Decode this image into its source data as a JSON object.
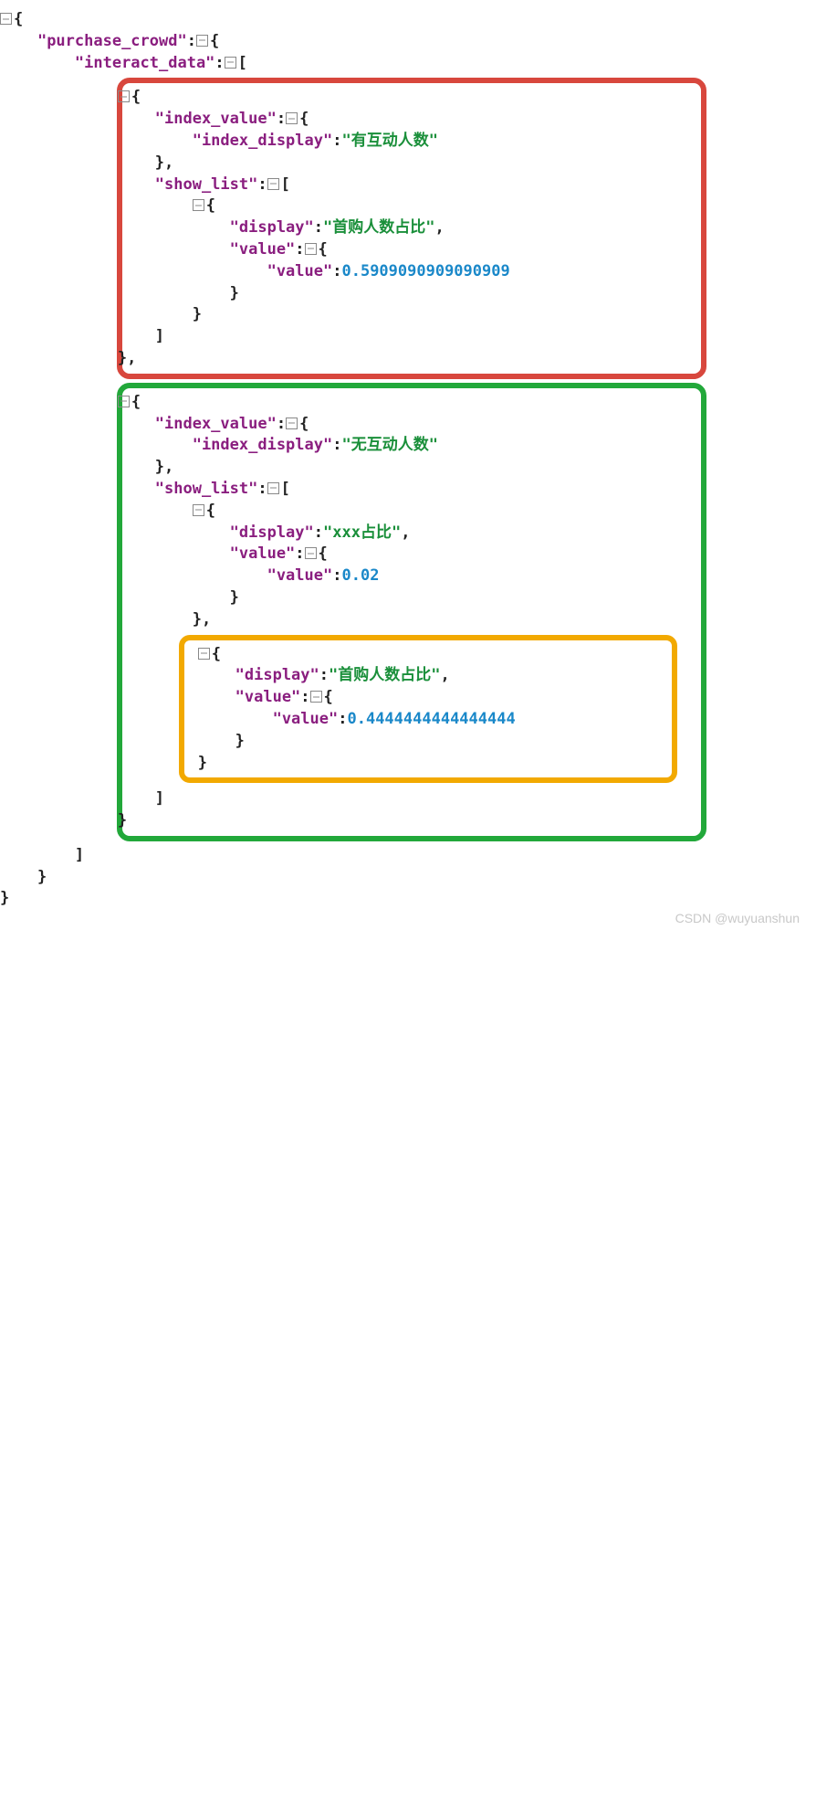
{
  "root": {
    "k_purchase_crowd": "\"purchase_crowd\"",
    "k_interact_data": "\"interact_data\"",
    "k_index_value": "\"index_value\"",
    "k_index_display": "\"index_display\"",
    "k_show_list": "\"show_list\"",
    "k_display": "\"display\"",
    "k_value": "\"value\""
  },
  "vals": {
    "idx1": "\"有互动人数\"",
    "idx2": "\"无互动人数\"",
    "disp1": "\"首购人数占比\"",
    "disp2": "\"xxx占比\"",
    "disp3": "\"首购人数占比\"",
    "num1": "0.5909090909090909",
    "num2": "0.02",
    "num3": "0.4444444444444444"
  },
  "punct": {
    "brace_open": "{",
    "brace_close": "}",
    "bracket_open": "[",
    "bracket_close": "]",
    "colon": ":",
    "comma": ",",
    "brace_close_comma": "},"
  },
  "watermark": "CSDN @wuyuanshun"
}
